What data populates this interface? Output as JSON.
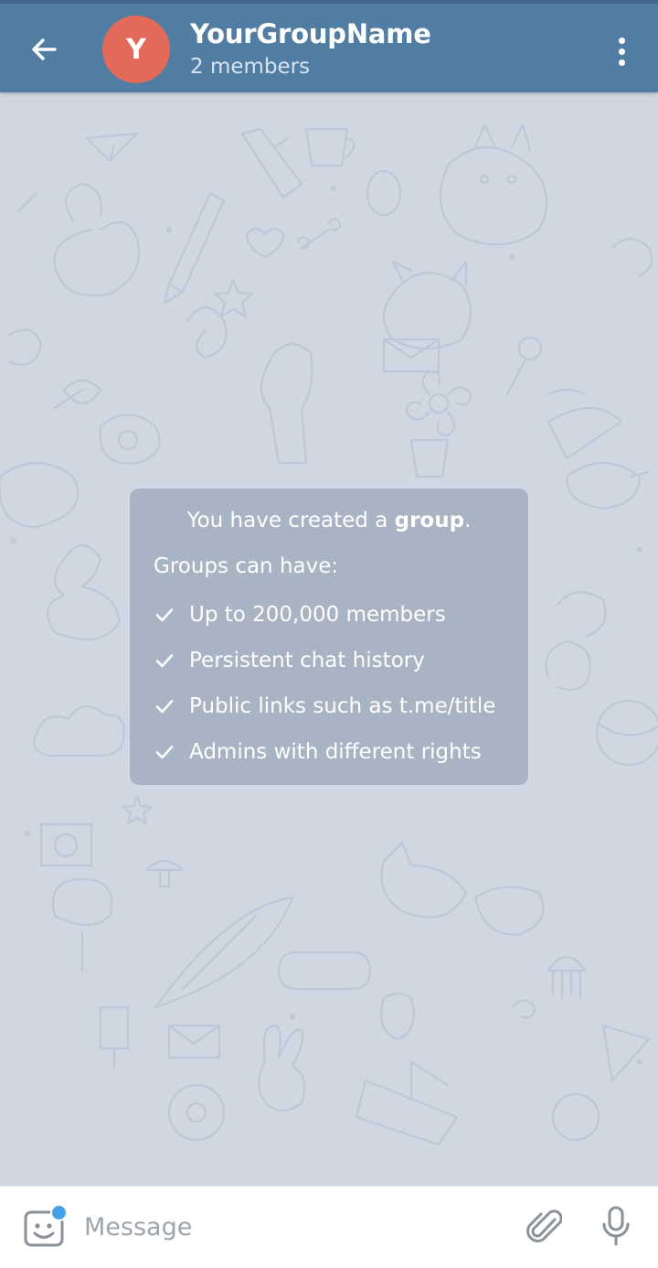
{
  "header": {
    "back_icon": "arrow-left-icon",
    "avatar_letter": "Y",
    "avatar_color": "#e36a5a",
    "title": "YourGroupName",
    "subtitle": "2 members",
    "menu_icon": "more-vertical-icon",
    "background_color": "#527da3"
  },
  "service_message": {
    "intro_prefix": "You have created a ",
    "intro_bold": "group",
    "intro_suffix": ".",
    "heading": "Groups can have:",
    "features": [
      "Up to 200,000 members",
      "Persistent chat history",
      "Public links such as t.me/title",
      "Admins with different rights"
    ],
    "feature_icon": "check-icon"
  },
  "chat": {
    "background_color": "#cfd8e2",
    "wallpaper": "doodle-pattern"
  },
  "input_bar": {
    "placeholder": "Message",
    "sticker_icon": "sticker-smile-icon",
    "sticker_badge_color": "#44a3e8",
    "attach_icon": "paperclip-icon",
    "mic_icon": "microphone-icon"
  }
}
